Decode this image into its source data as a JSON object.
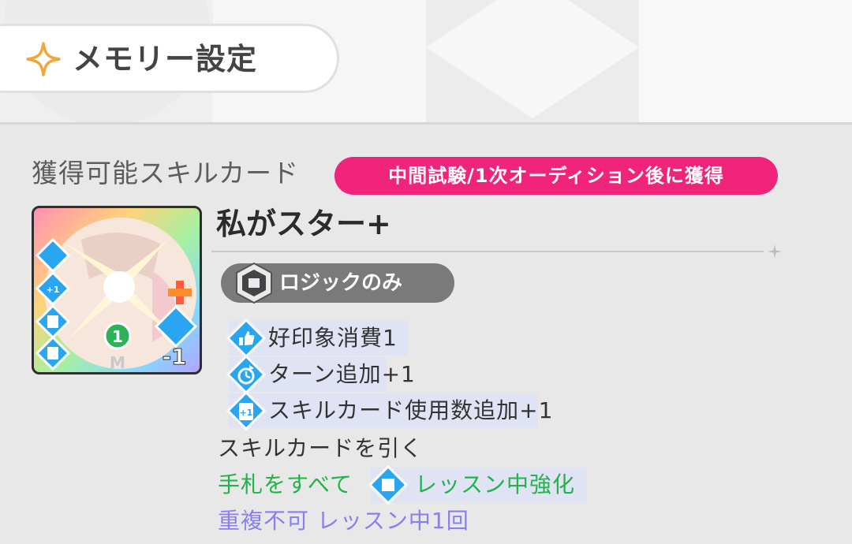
{
  "header": {
    "title": "メモリー設定",
    "icon": "sparkle-star-icon",
    "accent": "#f0a63a"
  },
  "skill_section": {
    "label": "獲得可能スキルカード",
    "timing_badge": "中間試験/1次オーディション後に獲得",
    "badge_color": "#f0247a"
  },
  "card": {
    "name": "私がスター+",
    "cost_number": "1",
    "cost_value": "-1",
    "plan_label": "ロジックのみ",
    "effects": [
      {
        "icon": "thumbs-up-icon",
        "text": "好印象消費1"
      },
      {
        "icon": "turn-add-icon",
        "text": "ターン追加+1"
      },
      {
        "icon": "card-plus-one-icon",
        "text": "スキルカード使用数追加+1"
      }
    ],
    "draw_text": "スキルカードを引く",
    "enhance_prefix": "手札をすべて",
    "enhance_text": "レッスン中強化",
    "limit_text": "重複不可 レッスン中1回"
  }
}
